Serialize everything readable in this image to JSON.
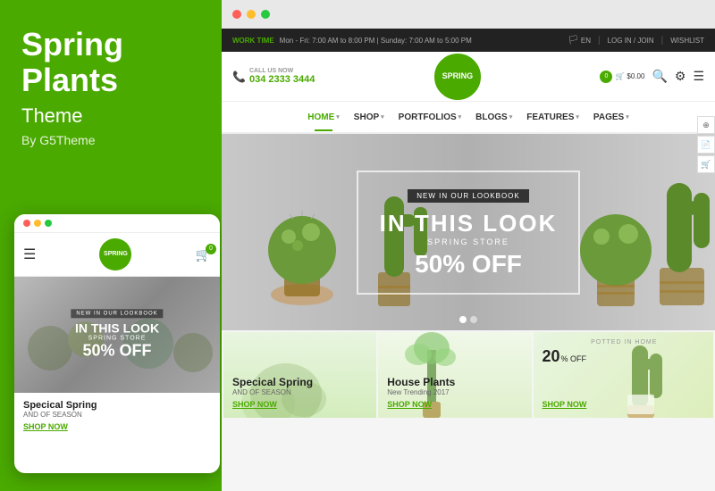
{
  "left": {
    "title": "Spring Plants",
    "subtitle": "Theme",
    "byline": "By G5Theme"
  },
  "mobile": {
    "hero_tag": "NEW IN OUR LOOKBOOK",
    "hero_title": "IN THIS LOOK",
    "hero_subtitle": "SPRING STORE",
    "hero_price": "50% OFF",
    "section_title": "Specical Spring",
    "section_sub": "AND OF SEASON",
    "shop_now": "SHOP NOW",
    "cart_count": "0"
  },
  "browser": {
    "topbar": {
      "work_time": "WORK TIME",
      "hours": "Mon - Fri: 7:00 AM to 8:00 PM  |  Sunday: 7:00 AM to 5:00 PM",
      "lang": "EN",
      "login": "LOG IN / JOIN",
      "wishlist": "WISHLIST"
    },
    "nav": {
      "call_label": "CALL US NOW",
      "phone": "034 2333 3444",
      "logo_text": "SPRING",
      "cart_amount": "$0.00",
      "cart_count": "0"
    },
    "menu": {
      "items": [
        "HOME",
        "SHOP",
        "PORTFOLIOS",
        "BLOGS",
        "FEATURES",
        "PAGES"
      ]
    },
    "hero": {
      "tag": "NEW IN OUR LOOKBOOK",
      "title": "IN THIS LOOK",
      "subtitle": "SPRING STORE",
      "price": "50% OFF"
    },
    "cards": [
      {
        "title": "Specical Spring",
        "subtitle": "AND OF SEASON",
        "shop_now": "SHOP NOW"
      },
      {
        "title": "House Plants",
        "subtitle": "New Trending 2017",
        "shop_now": "SHOP NOW"
      },
      {
        "label": "POTTED IN HOME",
        "badge_pct": "20",
        "badge_suffix": "% OFF",
        "shop_now": "SHOP NOW"
      }
    ]
  }
}
